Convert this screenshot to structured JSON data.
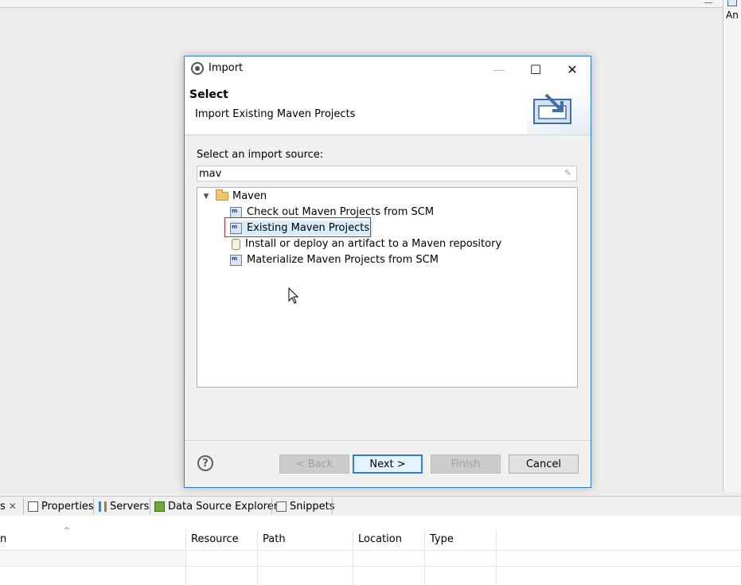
{
  "background": {
    "right_panel_label": "An",
    "bottom_tabs": [
      {
        "label": "s",
        "icon": "close-icon"
      },
      {
        "label": "Properties",
        "icon": "properties-icon"
      },
      {
        "label": "Servers",
        "icon": "servers-icon"
      },
      {
        "label": "Data Source Explorer",
        "icon": "database-icon"
      },
      {
        "label": "Snippets",
        "icon": "snippets-icon"
      }
    ],
    "table_columns": [
      "n",
      "Resource",
      "Path",
      "Location",
      "Type"
    ]
  },
  "dialog": {
    "title": "Import",
    "window_buttons": {
      "minimize": "—",
      "maximize": "☐",
      "close": "✕"
    },
    "header_title": "Select",
    "header_subtitle": "Import Existing Maven Projects",
    "source_label": "Select an import source:",
    "filter_value": "mav",
    "tree": {
      "group": "Maven",
      "items": [
        {
          "label": "Check out Maven Projects from SCM",
          "icon": "maven-project-icon"
        },
        {
          "label": "Existing Maven Projects",
          "icon": "maven-project-icon",
          "selected": true
        },
        {
          "label": "Install or deploy an artifact to a Maven repository",
          "icon": "jar-icon"
        },
        {
          "label": "Materialize Maven Projects from SCM",
          "icon": "maven-project-icon"
        }
      ]
    },
    "buttons": {
      "help": "?",
      "back": "< Back",
      "next": "Next >",
      "finish": "Finish",
      "cancel": "Cancel"
    },
    "accent_color": "#2f7fd8",
    "highlight_color": "#e02020"
  }
}
